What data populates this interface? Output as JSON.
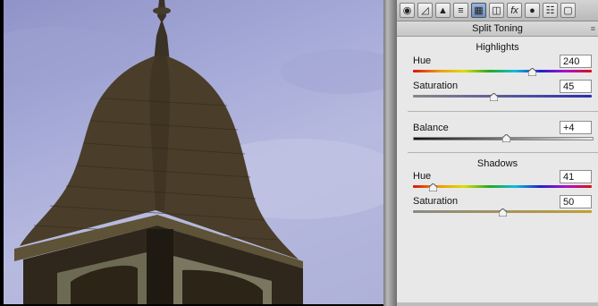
{
  "toolbar": {
    "tools": [
      {
        "icon": "aperture-icon",
        "glyph": "◉"
      },
      {
        "icon": "tone-curve-icon",
        "glyph": "◿"
      },
      {
        "icon": "detail-icon",
        "glyph": "▲"
      },
      {
        "icon": "hsl-icon",
        "glyph": "≡"
      },
      {
        "icon": "split-toning-icon",
        "glyph": "▦",
        "active": true
      },
      {
        "icon": "lens-corrections-icon",
        "glyph": "◫"
      },
      {
        "icon": "effects-icon",
        "glyph": "fx"
      },
      {
        "icon": "camera-calibration-icon",
        "glyph": "●"
      },
      {
        "icon": "presets-icon",
        "glyph": "☷"
      },
      {
        "icon": "snapshots-icon",
        "glyph": "▢"
      }
    ]
  },
  "panel": {
    "title": "Split Toning",
    "highlights": {
      "heading": "Highlights",
      "hue_label": "Hue",
      "hue_value": "240",
      "hue_fraction": 0.667,
      "saturation_label": "Saturation",
      "saturation_value": "45",
      "saturation_fraction": 0.45
    },
    "balance": {
      "label": "Balance",
      "value": "+4",
      "fraction": 0.52
    },
    "shadows": {
      "heading": "Shadows",
      "hue_label": "Hue",
      "hue_value": "41",
      "hue_fraction": 0.114,
      "saturation_label": "Saturation",
      "saturation_value": "50",
      "saturation_fraction": 0.5
    }
  },
  "colors": {
    "panel_bg": "#e8e8e8",
    "highlight_tint": "#2b2fb0",
    "shadow_tint": "#c0a030"
  }
}
